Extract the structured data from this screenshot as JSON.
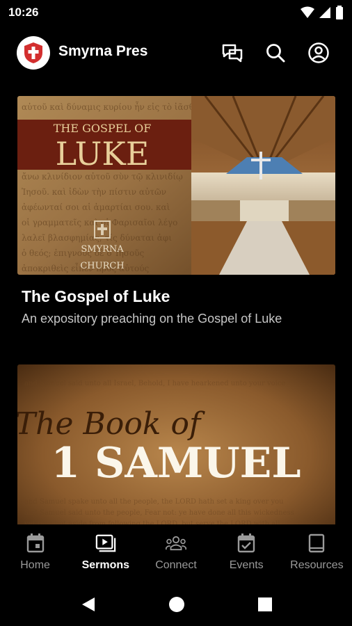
{
  "status_bar": {
    "time": "10:26"
  },
  "app": {
    "title": "Smyrna Pres"
  },
  "cards": [
    {
      "title": "The Gospel of Luke",
      "subtitle": "An expository preaching on the Gospel of Luke",
      "image_text": {
        "line1": "THE GOSPEL OF",
        "line2": "LUKE",
        "logo_line1": "SMYRNA",
        "logo_line2": "CHURCH"
      }
    },
    {
      "title": "",
      "subtitle": "",
      "image_text": {
        "line1": "The Book of",
        "line2": "1 SAMUEL"
      }
    }
  ],
  "nav": [
    {
      "label": "Home",
      "icon": "calendar-home-icon",
      "active": false
    },
    {
      "label": "Sermons",
      "icon": "video-library-icon",
      "active": true
    },
    {
      "label": "Connect",
      "icon": "groups-icon",
      "active": false
    },
    {
      "label": "Events",
      "icon": "event-check-icon",
      "active": false
    },
    {
      "label": "Resources",
      "icon": "book-icon",
      "active": false
    }
  ],
  "colors": {
    "background": "#000000",
    "logo_red": "#d32f2f",
    "nav_inactive": "#9a9a9a",
    "card_subtitle": "#c7c7c7"
  }
}
